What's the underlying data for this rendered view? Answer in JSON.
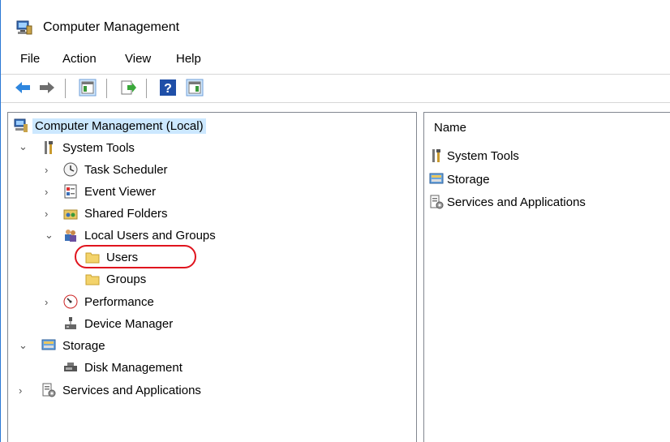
{
  "window": {
    "title": "Computer Management"
  },
  "menu": [
    "File",
    "Action",
    "View",
    "Help"
  ],
  "toolbar": {
    "buttons": [
      "back-icon",
      "forward-icon",
      "show-hide-console-tree-icon",
      "export-list-icon",
      "help-icon",
      "show-hide-action-pane-icon"
    ]
  },
  "tree": {
    "root": "Computer Management (Local)",
    "system_tools": "System Tools",
    "task_scheduler": "Task Scheduler",
    "event_viewer": "Event Viewer",
    "shared_folders": "Shared Folders",
    "local_users_groups": "Local Users and Groups",
    "users": "Users",
    "groups": "Groups",
    "performance": "Performance",
    "device_manager": "Device Manager",
    "storage": "Storage",
    "disk_management": "Disk Management",
    "services_apps": "Services and Applications"
  },
  "list": {
    "column_header": "Name",
    "items": [
      "System Tools",
      "Storage",
      "Services and Applications"
    ]
  },
  "colors": {
    "accent_border": "#2b78d4",
    "selection": "#cce8ff",
    "annotation": "#e0141e"
  }
}
